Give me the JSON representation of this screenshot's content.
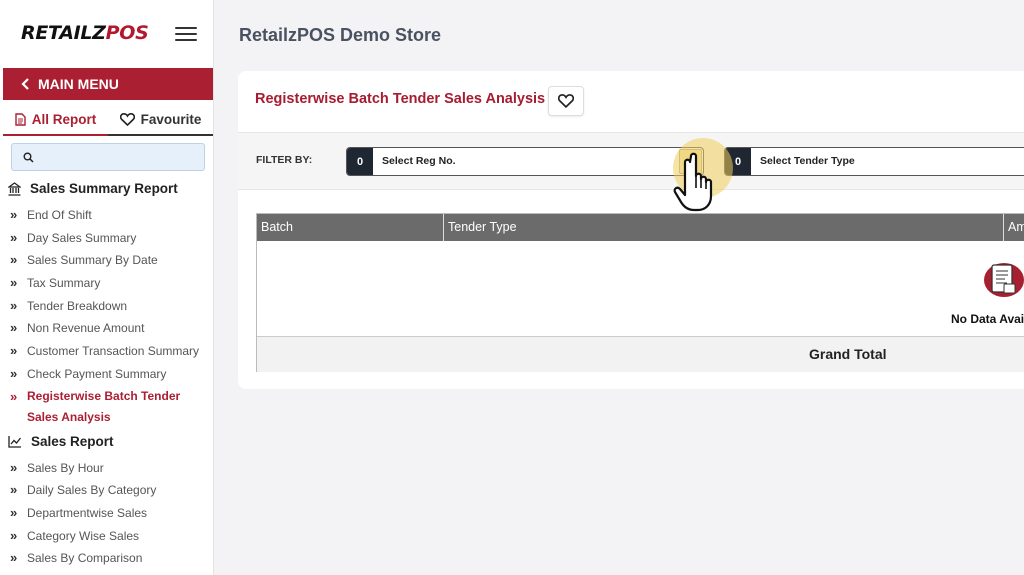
{
  "sidebar": {
    "logo": {
      "main": "RETAILZ",
      "accent": "POS"
    },
    "main_menu_label": "MAIN MENU",
    "tabs": [
      {
        "label": "All Report",
        "icon": "document-icon"
      },
      {
        "label": "Favourite",
        "icon": "heart-icon"
      }
    ],
    "search_placeholder": "",
    "sections": [
      {
        "title": "Sales Summary Report",
        "icon": "bank-icon",
        "items": [
          "End Of Shift",
          "Day Sales Summary",
          "Sales Summary By Date",
          "Tax Summary",
          "Tender Breakdown",
          "Non Revenue Amount",
          "Customer Transaction Summary",
          "Check Payment Summary",
          "Registerwise Batch Tender Sales Analysis"
        ]
      },
      {
        "title": "Sales Report",
        "icon": "line-chart-icon",
        "items": [
          "Sales By Hour",
          "Daily Sales By Category",
          "Departmentwise Sales",
          "Category Wise Sales",
          "Sales By Comparison"
        ]
      }
    ]
  },
  "header": {
    "store_title": "RetailzPOS Demo Store"
  },
  "report": {
    "title": "Registerwise Batch Tender Sales Analysis",
    "filter_label": "FILTER BY:",
    "filters": [
      {
        "count": "0",
        "placeholder": "Select Reg No."
      },
      {
        "count": "0",
        "placeholder": "Select Tender Type"
      }
    ],
    "table": {
      "columns": [
        "Batch",
        "Tender Type",
        "Am"
      ],
      "empty_text": "No Data Avai",
      "grand_total_label": "Grand Total"
    }
  },
  "colors": {
    "brand": "#ab1f32",
    "header_gray": "#6b6b6b",
    "dark_badge": "#1f2733"
  }
}
